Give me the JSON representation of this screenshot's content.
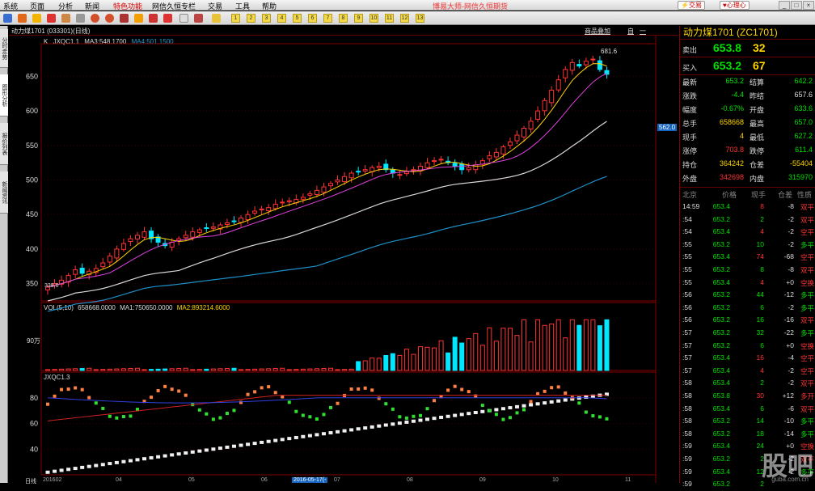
{
  "menu": {
    "items": [
      "系统",
      "页面",
      "分析",
      "新闻",
      "特色功能",
      "网信久恒专栏",
      "交易",
      "工具",
      "帮助"
    ],
    "title": "博易大师-网信久恒期货",
    "trade_label": "交易",
    "heart_label": "心理心",
    "hot_item": "特色功能"
  },
  "toolbar": {
    "num_buttons": [
      "1",
      "2",
      "3",
      "4",
      "5",
      "6",
      "7",
      "8",
      "9",
      "10",
      "11",
      "12",
      "13"
    ]
  },
  "left_tabs": [
    "分时走势",
    "图形分析",
    "报价列表",
    "新闻资讯"
  ],
  "chart": {
    "header_title": "动力煤1701 (033301)(日线)",
    "header_buttons": [
      "商品叠加",
      "自",
      "一"
    ],
    "main_legend": {
      "k": "K",
      "name": "JXQC1.1",
      "ma3": "MA3:548.1700",
      "ma4": "MA4:501.1500"
    },
    "vol_legend": {
      "name": "VOL(5,10)",
      "value": "658668.0000",
      "ma1": "MA1:750650.0000",
      "ma2": "MA2:893214.6000"
    },
    "ind_legend": "JXQC1.3",
    "peak_label": "681.6",
    "low_label": "338.0",
    "price_marker": "562.0",
    "vol_tick": "90万",
    "bottom_axis_label": "日线",
    "bottom_date_label": "2016-05-17(-"
  },
  "chart_data": {
    "type": "candlestick",
    "price_axis": {
      "ticks": [
        350,
        400,
        450,
        500,
        550,
        600,
        650
      ],
      "ylim": [
        325,
        695
      ]
    },
    "volume_axis": {
      "ticks": [
        "90万"
      ]
    },
    "indicator_axis": {
      "ticks": [
        40,
        60,
        80
      ],
      "ylim": [
        20,
        100
      ]
    },
    "x_ticks": [
      "201602",
      "04",
      "05",
      "06",
      "07",
      "08",
      "09",
      "10",
      "11"
    ],
    "close_series": [
      345,
      350,
      355,
      362,
      370,
      365,
      368,
      372,
      380,
      390,
      400,
      408,
      415,
      420,
      425,
      415,
      410,
      405,
      410,
      415,
      420,
      425,
      428,
      430,
      432,
      435,
      438,
      440,
      445,
      450,
      455,
      458,
      460,
      465,
      468,
      470,
      472,
      475,
      480,
      485,
      490,
      495,
      500,
      505,
      510,
      512,
      515,
      518,
      520,
      515,
      510,
      508,
      512,
      515,
      520,
      525,
      528,
      530,
      525,
      520,
      515,
      518,
      522,
      528,
      535,
      540,
      548,
      555,
      565,
      575,
      585,
      600,
      615,
      630,
      645,
      660,
      670,
      665,
      672,
      675,
      660,
      653
    ],
    "ma3_end": 548.17,
    "ma4_end": 501.15,
    "last_volume": 658668,
    "vol_ma1": 750650,
    "vol_ma2": 893214.6
  },
  "sidebar": {
    "contract": "动力煤1701 (ZC1701)",
    "ask_label": "卖出",
    "ask_price": "653.8",
    "ask_vol": "32",
    "bid_label": "买入",
    "bid_price": "653.2",
    "bid_vol": "67",
    "stats": [
      {
        "l1": "最新",
        "v1": "653.2",
        "c1": "g",
        "l2": "结算",
        "v2": "642.2",
        "c2": "g"
      },
      {
        "l1": "涨跌",
        "v1": "-4.4",
        "c1": "g",
        "l2": "昨结",
        "v2": "657.6",
        "c2": "w"
      },
      {
        "l1": "幅度",
        "v1": "-0.67%",
        "c1": "g",
        "l2": "开盘",
        "v2": "633.6",
        "c2": "g"
      },
      {
        "l1": "总手",
        "v1": "658668",
        "c1": "y",
        "l2": "最高",
        "v2": "657.0",
        "c2": "g"
      },
      {
        "l1": "现手",
        "v1": "4",
        "c1": "y",
        "l2": "最低",
        "v2": "627.2",
        "c2": "g"
      },
      {
        "l1": "涨停",
        "v1": "703.8",
        "c1": "r",
        "l2": "跌停",
        "v2": "611.4",
        "c2": "g"
      },
      {
        "l1": "持仓",
        "v1": "364242",
        "c1": "y",
        "l2": "仓差",
        "v2": "-55404",
        "c2": "y"
      },
      {
        "l1": "外盘",
        "v1": "342698",
        "c1": "r",
        "l2": "内盘",
        "v2": "315970",
        "c2": "g"
      }
    ],
    "tick_headers": [
      "北京",
      "价格",
      "现手",
      "仓差",
      "性质"
    ],
    "ticks": [
      {
        "t": "14:59",
        "p": "653.4",
        "v": "8",
        "d": "-8",
        "n": "双平",
        "pc": "g",
        "vc": "r",
        "nc": "r"
      },
      {
        "t": ":54",
        "p": "653.2",
        "v": "2",
        "d": "-2",
        "n": "双平",
        "pc": "g",
        "vc": "g",
        "nc": "r"
      },
      {
        "t": ":54",
        "p": "653.4",
        "v": "4",
        "d": "-2",
        "n": "空平",
        "pc": "g",
        "vc": "r",
        "nc": "r"
      },
      {
        "t": ":55",
        "p": "653.2",
        "v": "10",
        "d": "-2",
        "n": "多平",
        "pc": "g",
        "vc": "g",
        "nc": "g"
      },
      {
        "t": ":55",
        "p": "653.4",
        "v": "74",
        "d": "-68",
        "n": "空平",
        "pc": "g",
        "vc": "r",
        "nc": "r"
      },
      {
        "t": ":55",
        "p": "653.2",
        "v": "8",
        "d": "-8",
        "n": "双平",
        "pc": "g",
        "vc": "g",
        "nc": "r"
      },
      {
        "t": ":55",
        "p": "653.4",
        "v": "4",
        "d": "+0",
        "n": "空换",
        "pc": "g",
        "vc": "r",
        "nc": "r"
      },
      {
        "t": ":56",
        "p": "653.2",
        "v": "44",
        "d": "-12",
        "n": "多平",
        "pc": "g",
        "vc": "g",
        "nc": "g"
      },
      {
        "t": ":56",
        "p": "653.2",
        "v": "6",
        "d": "-2",
        "n": "多平",
        "pc": "g",
        "vc": "g",
        "nc": "g"
      },
      {
        "t": ":56",
        "p": "653.2",
        "v": "16",
        "d": "-16",
        "n": "双平",
        "pc": "g",
        "vc": "g",
        "nc": "r"
      },
      {
        "t": ":57",
        "p": "653.2",
        "v": "32",
        "d": "-22",
        "n": "多平",
        "pc": "g",
        "vc": "g",
        "nc": "g"
      },
      {
        "t": ":57",
        "p": "653.2",
        "v": "6",
        "d": "+0",
        "n": "空换",
        "pc": "g",
        "vc": "g",
        "nc": "r"
      },
      {
        "t": ":57",
        "p": "653.4",
        "v": "16",
        "d": "-4",
        "n": "空平",
        "pc": "g",
        "vc": "r",
        "nc": "r"
      },
      {
        "t": ":57",
        "p": "653.4",
        "v": "4",
        "d": "-2",
        "n": "空平",
        "pc": "g",
        "vc": "r",
        "nc": "r"
      },
      {
        "t": ":58",
        "p": "653.4",
        "v": "2",
        "d": "-2",
        "n": "双平",
        "pc": "g",
        "vc": "g",
        "nc": "r"
      },
      {
        "t": ":58",
        "p": "653.8",
        "v": "30",
        "d": "+12",
        "n": "多开",
        "pc": "g",
        "vc": "r",
        "nc": "r"
      },
      {
        "t": ":58",
        "p": "653.4",
        "v": "6",
        "d": "-6",
        "n": "双平",
        "pc": "g",
        "vc": "g",
        "nc": "r"
      },
      {
        "t": ":58",
        "p": "653.2",
        "v": "14",
        "d": "-10",
        "n": "多平",
        "pc": "g",
        "vc": "g",
        "nc": "g"
      },
      {
        "t": ":58",
        "p": "653.2",
        "v": "18",
        "d": "-14",
        "n": "多平",
        "pc": "g",
        "vc": "g",
        "nc": "g"
      },
      {
        "t": ":59",
        "p": "653.4",
        "v": "24",
        "d": "+0",
        "n": "空换",
        "pc": "g",
        "vc": "g",
        "nc": "r"
      },
      {
        "t": ":59",
        "p": "653.2",
        "v": "2",
        "d": "-2",
        "n": "双平",
        "pc": "g",
        "vc": "g",
        "nc": "r"
      },
      {
        "t": ":59",
        "p": "653.4",
        "v": "12",
        "d": "-2",
        "n": "多平",
        "pc": "g",
        "vc": "g",
        "nc": "g"
      },
      {
        "t": ":59",
        "p": "653.2",
        "v": "2",
        "d": "",
        "n": "",
        "pc": "g",
        "vc": "g",
        "nc": "g"
      }
    ]
  },
  "watermark": {
    "text": "股吧",
    "url": "guba.com.cn"
  },
  "colors": {
    "up": "#ff3333",
    "down": "#00e8ff",
    "ma_white": "#d8d8d8",
    "ma_blue": "#1e90c8",
    "panel_border": "#800000"
  }
}
